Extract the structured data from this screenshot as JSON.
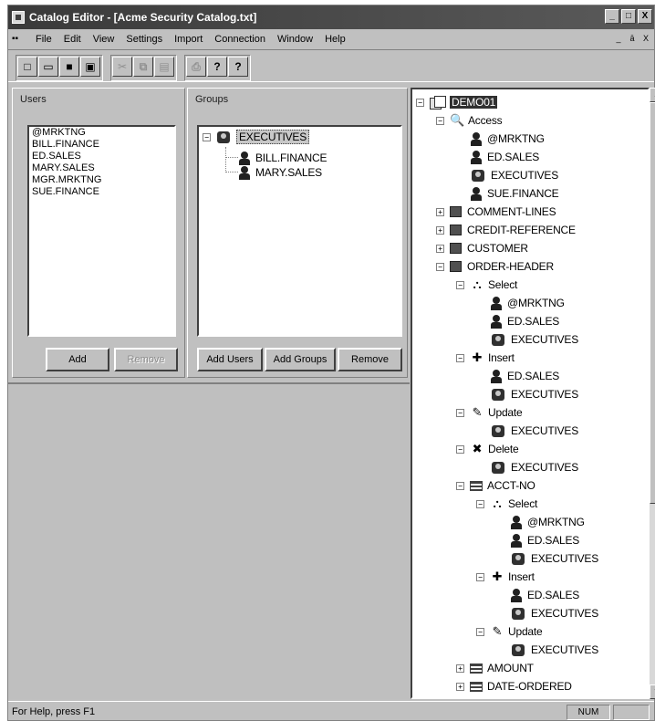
{
  "window": {
    "title": "Catalog Editor - [Acme Security Catalog.txt]",
    "controls": [
      "_",
      "□",
      "X"
    ],
    "mdi_controls": [
      "_",
      "ā",
      "X"
    ]
  },
  "menu": [
    "File",
    "Edit",
    "View",
    "Settings",
    "Import",
    "Connection",
    "Window",
    "Help"
  ],
  "toolbar": {
    "groups": [
      [
        {
          "icon": "new-icon",
          "glyph": "□"
        },
        {
          "icon": "open-icon",
          "glyph": "▭"
        },
        {
          "icon": "save-icon",
          "glyph": "■"
        },
        {
          "icon": "save-all-icon",
          "glyph": "▣"
        }
      ],
      [
        {
          "icon": "cut-icon",
          "glyph": "✂"
        },
        {
          "icon": "copy-icon",
          "glyph": "⧉"
        },
        {
          "icon": "paste-icon",
          "glyph": "▤"
        }
      ],
      [
        {
          "icon": "print-icon",
          "glyph": "⎙"
        },
        {
          "icon": "help-icon",
          "glyph": "?"
        },
        {
          "icon": "context-help-icon",
          "glyph": "?"
        }
      ]
    ]
  },
  "users_panel": {
    "label": "Users",
    "items": [
      "@MRKTNG",
      "BILL.FINANCE",
      "ED.SALES",
      "MARY.SALES",
      "MGR.MRKTNG",
      "SUE.FINANCE"
    ],
    "add_label": "Add",
    "remove_label": "Remove"
  },
  "groups_panel": {
    "label": "Groups",
    "group": "EXECUTIVES",
    "expander": "−",
    "members": [
      "BILL.FINANCE",
      "MARY.SALES"
    ],
    "add_users_label": "Add Users",
    "add_groups_label": "Add Groups",
    "remove_label": "Remove"
  },
  "tree": [
    {
      "d": 0,
      "exp": "−",
      "icon": "db",
      "label": "DEMO01",
      "sel": true
    },
    {
      "d": 1,
      "exp": "−",
      "icon": "key",
      "label": "Access"
    },
    {
      "d": 2,
      "icon": "user",
      "label": "@MRKTNG"
    },
    {
      "d": 2,
      "icon": "user",
      "label": "ED.SALES"
    },
    {
      "d": 2,
      "icon": "group",
      "label": "EXECUTIVES"
    },
    {
      "d": 2,
      "icon": "user",
      "label": "SUE.FINANCE"
    },
    {
      "d": 1,
      "exp": "+",
      "icon": "table",
      "label": "COMMENT-LINES"
    },
    {
      "d": 1,
      "exp": "+",
      "icon": "table",
      "label": "CREDIT-REFERENCE"
    },
    {
      "d": 1,
      "exp": "+",
      "icon": "table",
      "label": "CUSTOMER"
    },
    {
      "d": 1,
      "exp": "−",
      "icon": "table",
      "label": "ORDER-HEADER"
    },
    {
      "d": 2,
      "exp": "−",
      "icon": "select",
      "label": "Select"
    },
    {
      "d": 3,
      "icon": "user",
      "label": "@MRKTNG"
    },
    {
      "d": 3,
      "icon": "user",
      "label": "ED.SALES"
    },
    {
      "d": 3,
      "icon": "group",
      "label": "EXECUTIVES"
    },
    {
      "d": 2,
      "exp": "−",
      "icon": "insert",
      "label": "Insert"
    },
    {
      "d": 3,
      "icon": "user",
      "label": "ED.SALES"
    },
    {
      "d": 3,
      "icon": "group",
      "label": "EXECUTIVES"
    },
    {
      "d": 2,
      "exp": "−",
      "icon": "update",
      "label": "Update"
    },
    {
      "d": 3,
      "icon": "group",
      "label": "EXECUTIVES"
    },
    {
      "d": 2,
      "exp": "−",
      "icon": "delete",
      "label": "Delete"
    },
    {
      "d": 3,
      "icon": "group",
      "label": "EXECUTIVES"
    },
    {
      "d": 2,
      "exp": "−",
      "icon": "column",
      "label": "ACCT-NO"
    },
    {
      "d": 3,
      "exp": "−",
      "icon": "select",
      "label": "Select"
    },
    {
      "d": 4,
      "icon": "user",
      "label": "@MRKTNG"
    },
    {
      "d": 4,
      "icon": "user",
      "label": "ED.SALES"
    },
    {
      "d": 4,
      "icon": "group",
      "label": "EXECUTIVES"
    },
    {
      "d": 3,
      "exp": "−",
      "icon": "insert",
      "label": "Insert"
    },
    {
      "d": 4,
      "icon": "user",
      "label": "ED.SALES"
    },
    {
      "d": 4,
      "icon": "group",
      "label": "EXECUTIVES"
    },
    {
      "d": 3,
      "exp": "−",
      "icon": "update",
      "label": "Update"
    },
    {
      "d": 4,
      "icon": "group",
      "label": "EXECUTIVES"
    },
    {
      "d": 2,
      "exp": "+",
      "icon": "column",
      "label": "AMOUNT"
    },
    {
      "d": 2,
      "exp": "+",
      "icon": "column",
      "label": "DATE-ORDERED"
    }
  ],
  "status": {
    "text": "For Help, press F1",
    "num": "NUM"
  }
}
